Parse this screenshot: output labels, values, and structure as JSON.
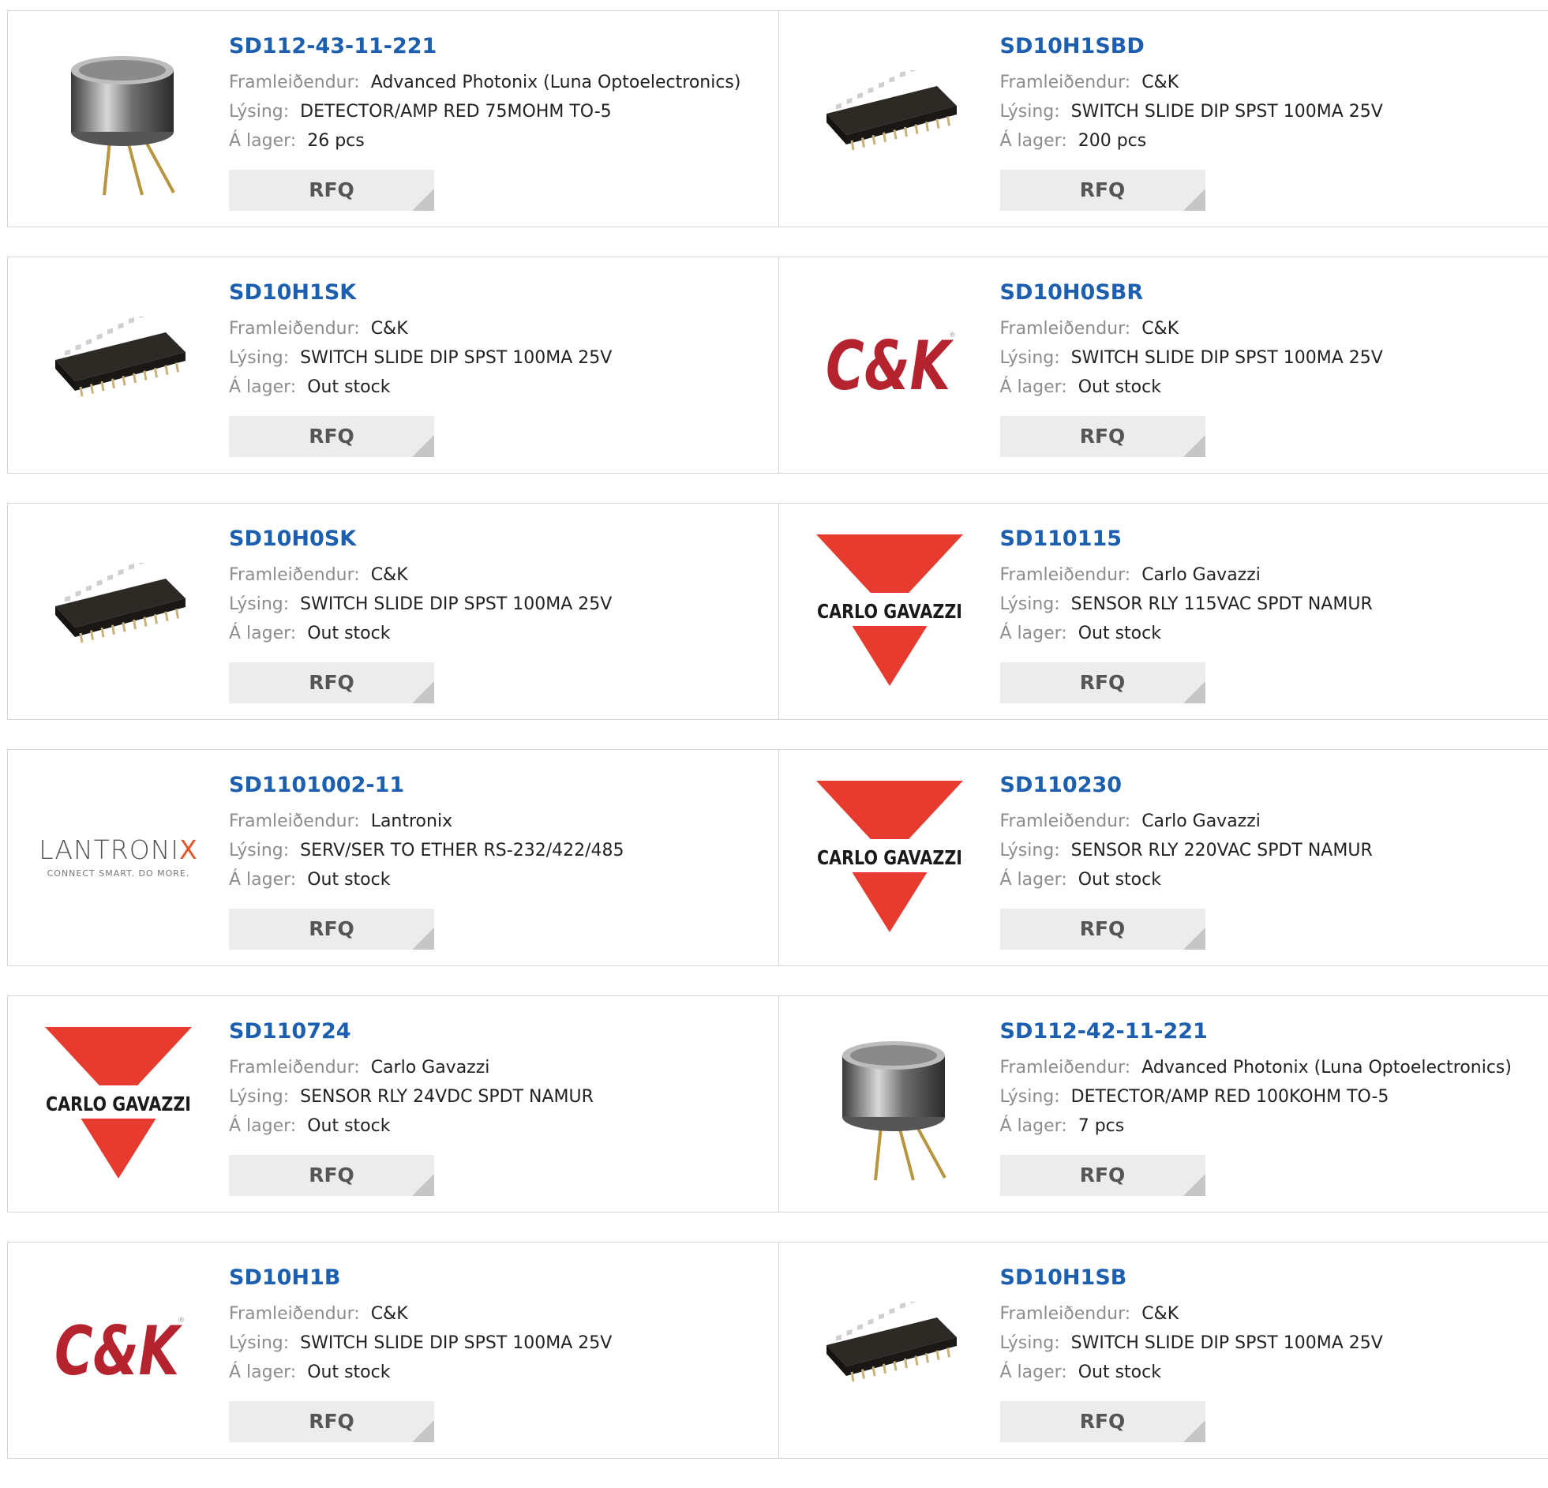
{
  "labels": {
    "manufacturer": "Framleiðendur:",
    "description": "Lýsing:",
    "stock": "Á lager:",
    "rfq": "RFQ"
  },
  "colors": {
    "link": "#1c5fb0",
    "ck_red": "#b5232f",
    "gavazzi_red": "#e63b2e",
    "lantronix_orange": "#e2562b"
  },
  "products": [
    {
      "part": "SD112-43-11-221",
      "manufacturer": "Advanced Photonix (Luna Optoelectronics)",
      "description": "DETECTOR/AMP RED 75MOHM TO-5",
      "stock": "26 pcs",
      "image": "to5-can-icon"
    },
    {
      "part": "SD10H1SBD",
      "manufacturer": "C&K",
      "description": "SWITCH SLIDE DIP SPST 100MA 25V",
      "stock": "200 pcs",
      "image": "dip-switch-icon"
    },
    {
      "part": "SD10H1SK",
      "manufacturer": "C&K",
      "description": "SWITCH SLIDE DIP SPST 100MA 25V",
      "stock": "Out stock",
      "image": "dip-switch-icon"
    },
    {
      "part": "SD10H0SBR",
      "manufacturer": "C&K",
      "description": "SWITCH SLIDE DIP SPST 100MA 25V",
      "stock": "Out stock",
      "image": "ck-logo"
    },
    {
      "part": "SD10H0SK",
      "manufacturer": "C&K",
      "description": "SWITCH SLIDE DIP SPST 100MA 25V",
      "stock": "Out stock",
      "image": "dip-switch-icon"
    },
    {
      "part": "SD110115",
      "manufacturer": "Carlo Gavazzi",
      "description": "SENSOR RLY 115VAC SPDT NAMUR",
      "stock": "Out stock",
      "image": "carlo-gavazzi-logo"
    },
    {
      "part": "SD1101002-11",
      "manufacturer": "Lantronix",
      "description": "SERV/SER TO ETHER RS-232/422/485",
      "stock": "Out stock",
      "image": "lantronix-logo"
    },
    {
      "part": "SD110230",
      "manufacturer": "Carlo Gavazzi",
      "description": "SENSOR RLY 220VAC SPDT NAMUR",
      "stock": "Out stock",
      "image": "carlo-gavazzi-logo"
    },
    {
      "part": "SD110724",
      "manufacturer": "Carlo Gavazzi",
      "description": "SENSOR RLY 24VDC SPDT NAMUR",
      "stock": "Out stock",
      "image": "carlo-gavazzi-logo"
    },
    {
      "part": "SD112-42-11-221",
      "manufacturer": "Advanced Photonix (Luna Optoelectronics)",
      "description": "DETECTOR/AMP RED 100KOHM TO-5",
      "stock": "7 pcs",
      "image": "to5-can-icon"
    },
    {
      "part": "SD10H1B",
      "manufacturer": "C&K",
      "description": "SWITCH SLIDE DIP SPST 100MA 25V",
      "stock": "Out stock",
      "image": "ck-logo"
    },
    {
      "part": "SD10H1SB",
      "manufacturer": "C&K",
      "description": "SWITCH SLIDE DIP SPST 100MA 25V",
      "stock": "Out stock",
      "image": "dip-switch-icon"
    }
  ],
  "logos": {
    "ck": "C&K",
    "carlo_gavazzi": "CARLO GAVAZZI",
    "lantronix_name": "LANTRONIX",
    "lantronix_tagline": "CONNECT SMART. DO MORE."
  }
}
